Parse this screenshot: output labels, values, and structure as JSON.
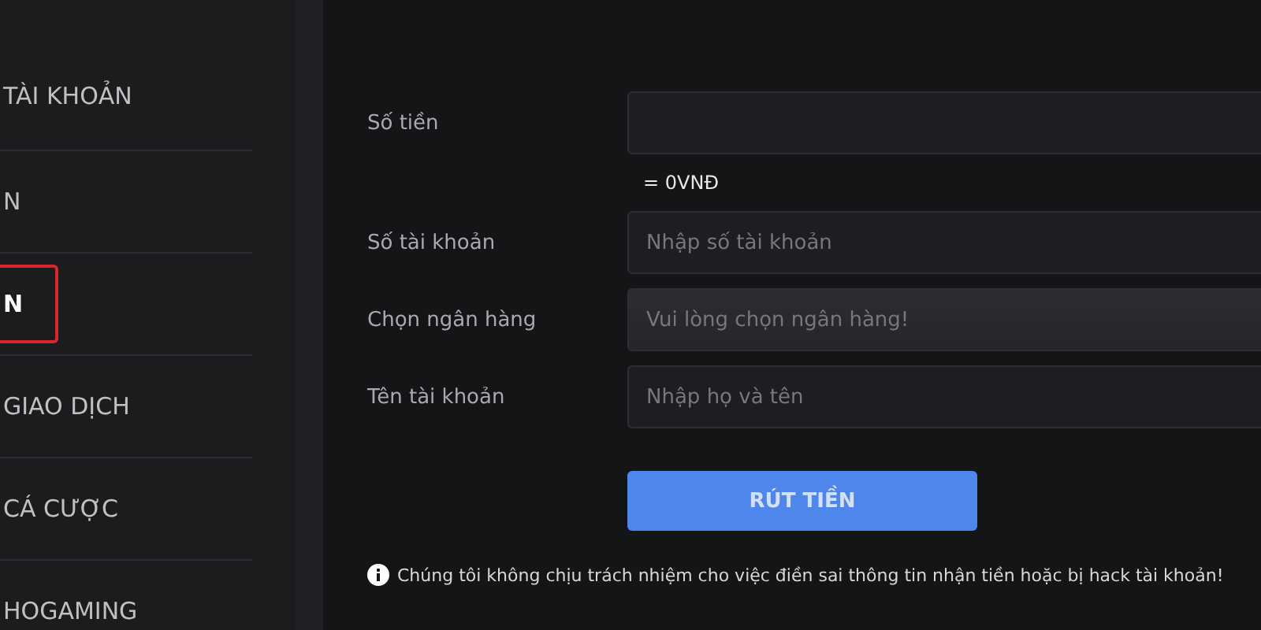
{
  "sidebar": {
    "items": [
      {
        "label": "TÀI KHOẢN",
        "selected": false
      },
      {
        "label": "N",
        "selected": false
      },
      {
        "label": "N",
        "selected": true
      },
      {
        "label": "GIAO DỊCH",
        "selected": false
      },
      {
        "label": "CÁ CƯỢC",
        "selected": false
      },
      {
        "label": "HOGAMING",
        "selected": false
      }
    ]
  },
  "form": {
    "fields": [
      {
        "kind": "input",
        "label": "Số tiền",
        "conversion": "= 0VNĐ"
      },
      {
        "kind": "input",
        "label": "Số tài khoản",
        "placeholder": "Nhập số tài khoản"
      },
      {
        "kind": "select",
        "label": "Chọn ngân hàng",
        "placeholder": "Vui lòng chọn ngân hàng!"
      },
      {
        "kind": "input",
        "label": "Tên tài khoản",
        "placeholder": "Nhập họ và tên"
      }
    ],
    "submit": "RÚT TIỀN",
    "notice": "Chúng tôi không chịu trách nhiệm cho việc điền sai thông tin nhận tiền hoặc bị hack tài khoản!"
  }
}
